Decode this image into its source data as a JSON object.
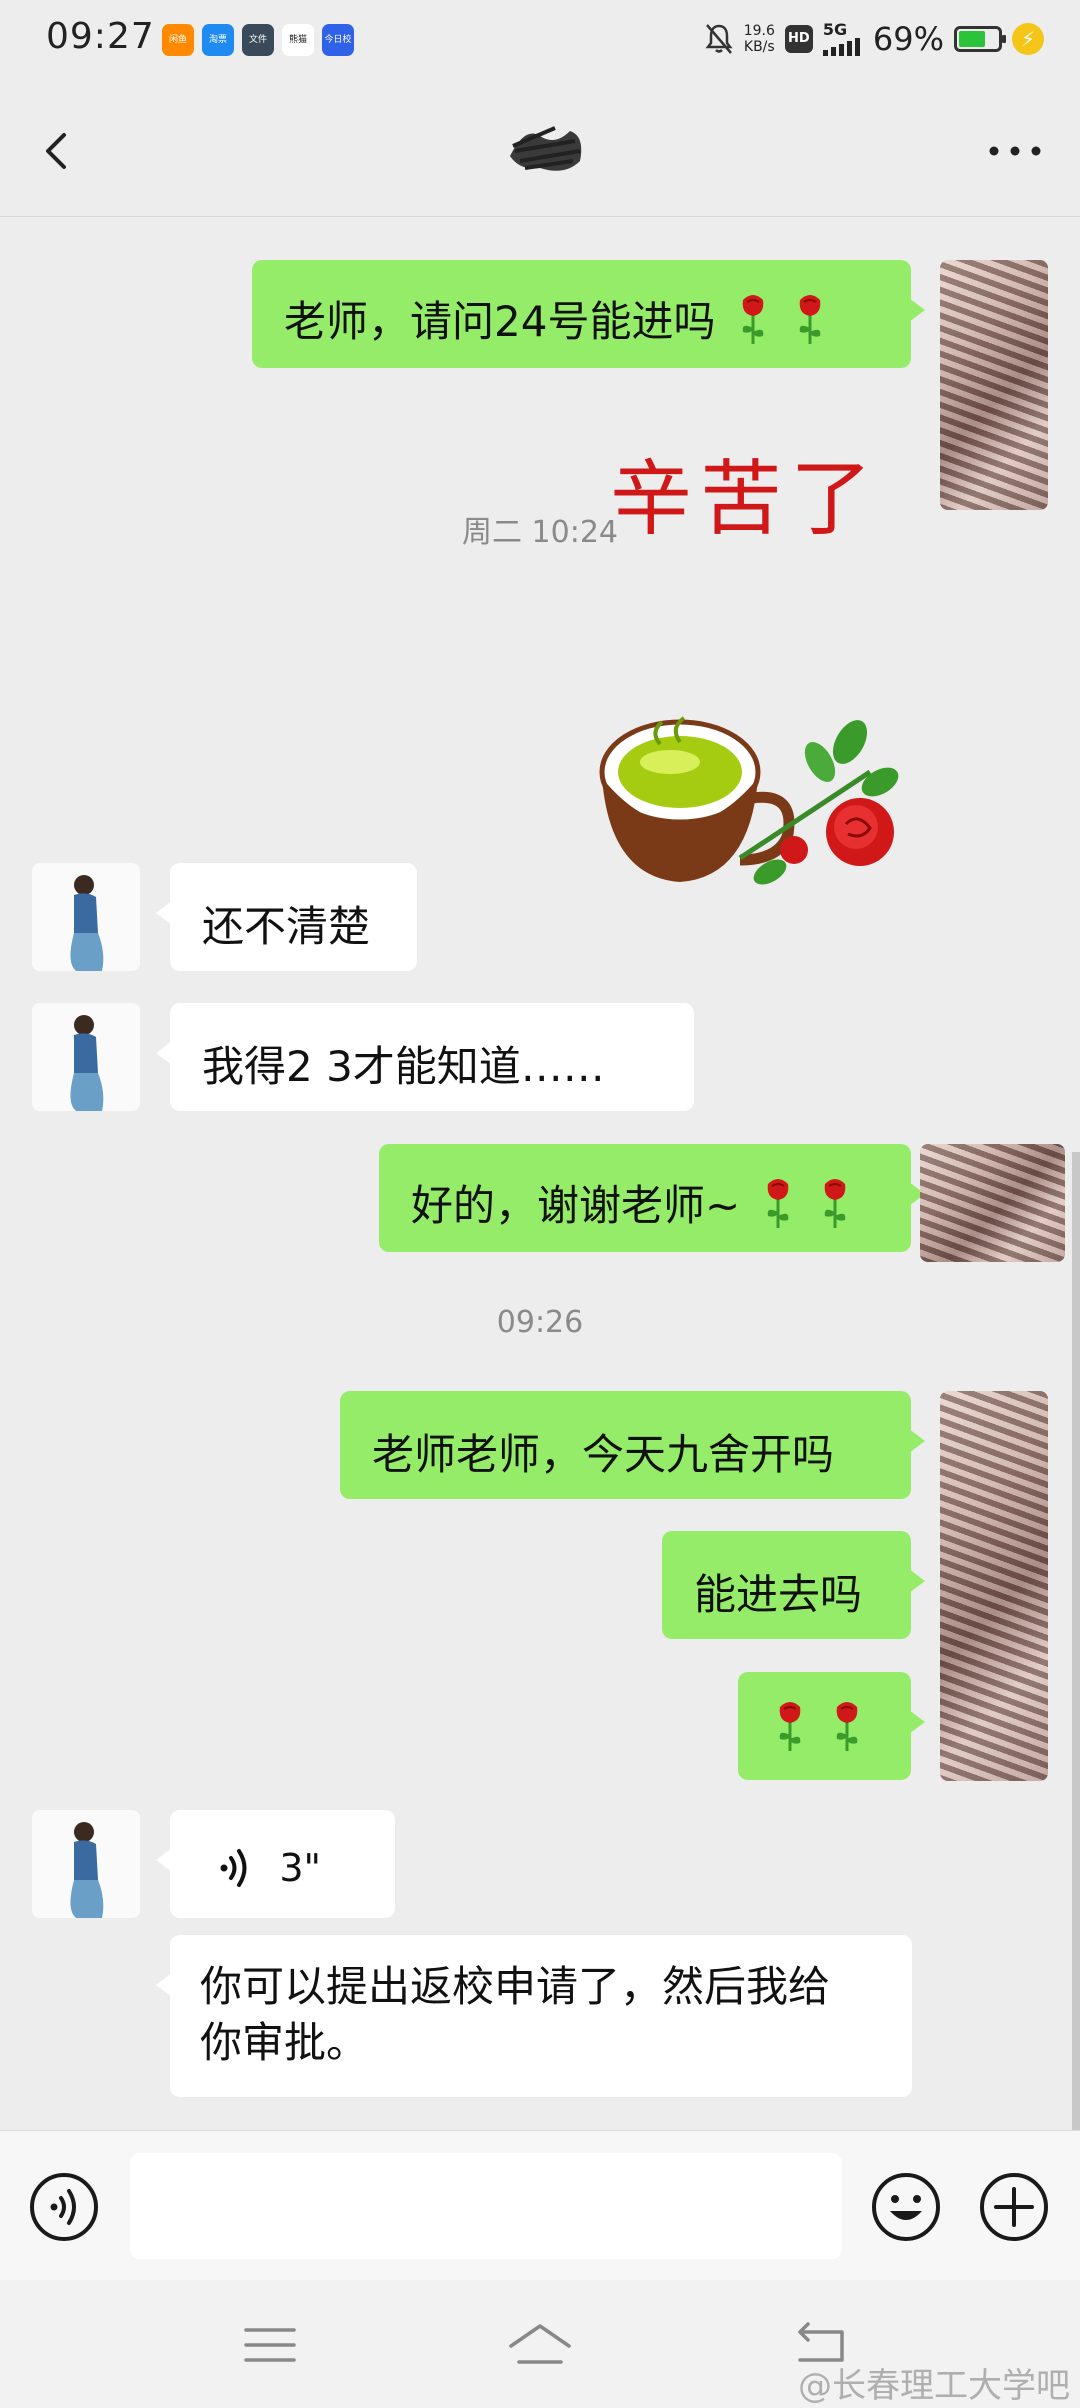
{
  "status_bar": {
    "time": "09:27",
    "net_speed_value": "19.6",
    "net_speed_unit": "KB/s",
    "hd": "HD",
    "network": "5G",
    "battery_percent": "69%",
    "battery_level": 0.69,
    "app_icons": [
      "闲鱼",
      "淘票",
      "文件",
      "熊猫",
      "今日校园"
    ]
  },
  "header": {
    "back_icon": "chevron-left-icon",
    "more_icon": "more-dots-icon"
  },
  "messages": {
    "m1": {
      "text": "老师，请问24号能进吗"
    },
    "sticker": {
      "title": "辛苦了"
    },
    "time1": "周二 10:24",
    "m2": {
      "text": "还不清楚"
    },
    "m3": {
      "text": "我得2 3才能知道……"
    },
    "m4": {
      "text": "好的，谢谢老师~"
    },
    "time2": "09:26",
    "m5": {
      "text": "老师老师，今天九舍开吗"
    },
    "m6": {
      "text": "能进去吗"
    },
    "m8": {
      "duration": "3\""
    },
    "m9": {
      "text_line1": "你可以提出返校申请了，然后我给",
      "text_line2": "你审批。"
    }
  },
  "input_bar": {
    "placeholder": "",
    "voice_icon": "voice-icon",
    "emoji_icon": "emoji-icon",
    "plus_icon": "plus-icon"
  },
  "nav": {
    "menu_icon": "menu-icon",
    "home_icon": "home-icon",
    "back_icon": "back-icon"
  },
  "watermark": "@长春理工大学吧",
  "colors": {
    "sent_bubble": "#95ec69",
    "recv_bubble": "#ffffff",
    "background": "#ededed"
  }
}
